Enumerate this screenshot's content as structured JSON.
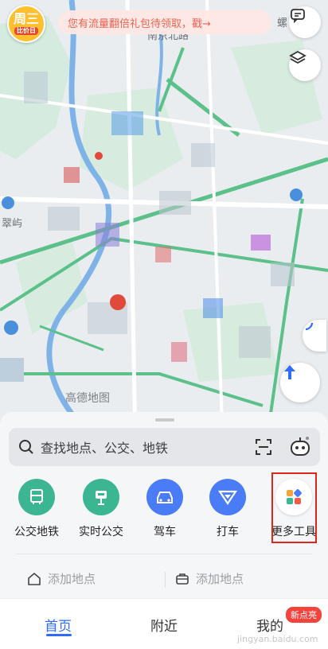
{
  "promo": {
    "badge_top": "周三",
    "badge_bottom": "比价日",
    "message": "您有流量翻倍礼包待领取，戳→"
  },
  "map": {
    "labels": {
      "street": "南京北路",
      "district": "翠屿",
      "north": "螺",
      "logo": "高德地图"
    }
  },
  "search": {
    "placeholder": "查找地点、公交、地铁"
  },
  "tools": [
    {
      "label": "公交地铁",
      "icon": "bus-icon",
      "color": "#3cb692"
    },
    {
      "label": "实时公交",
      "icon": "bus-stop-icon",
      "color": "#3cb692"
    },
    {
      "label": "驾车",
      "icon": "car-icon",
      "color": "#4a7cf7"
    },
    {
      "label": "打车",
      "icon": "taxi-icon",
      "color": "#4a7cf7"
    },
    {
      "label": "更多工具",
      "icon": "more-tools-icon",
      "color": "#ffffff"
    }
  ],
  "places": {
    "home": "添加地点",
    "work": "添加地点"
  },
  "tabbar": {
    "home": "首页",
    "nearby": "附近",
    "mine": "我的",
    "new_badge": "新点亮",
    "watermark": "jingyan.baidu.com"
  }
}
